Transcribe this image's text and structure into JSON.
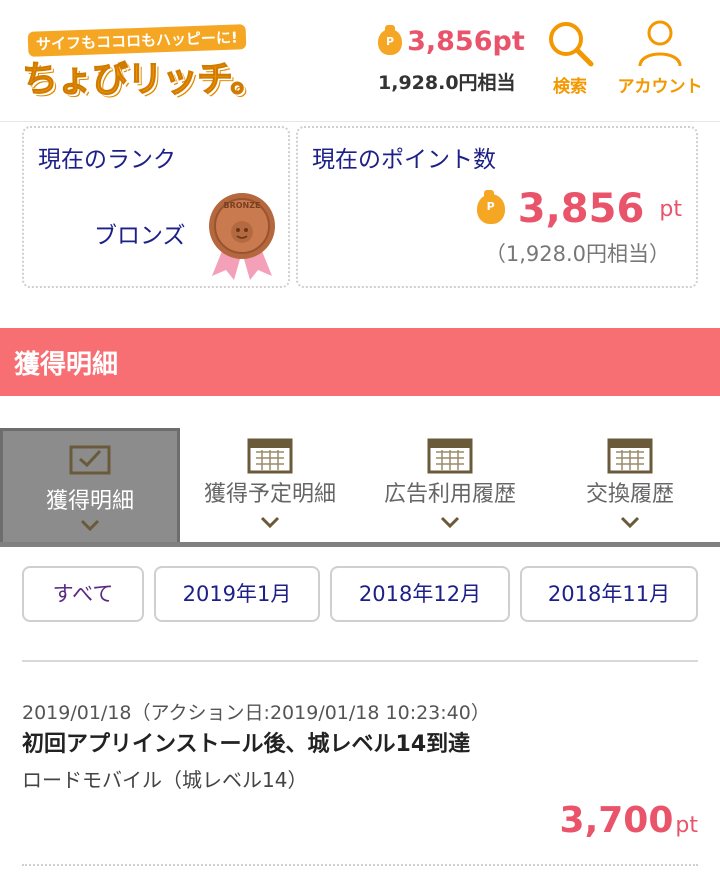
{
  "header": {
    "logo_tagline": "サイフもココロもハッピーに!",
    "logo_main": "ちょびリッチ。",
    "points": "3,856pt",
    "points_yen": "1,928.0円相当",
    "search_label": "検索",
    "account_label": "アカウント"
  },
  "rank_card": {
    "title": "現在のランク",
    "rank": "ブロンズ",
    "medal_text": "BRONZE"
  },
  "point_card": {
    "title": "現在のポイント数",
    "value": "3,856",
    "unit": "pt",
    "yen": "（1,928.0円相当）"
  },
  "section": {
    "title": "獲得明細"
  },
  "tabs": [
    {
      "label": "獲得明細",
      "icon": "envelope-check-icon",
      "active": true
    },
    {
      "label": "獲得予定明細",
      "icon": "calendar-icon",
      "active": false
    },
    {
      "label": "広告利用履歴",
      "icon": "calendar-icon",
      "active": false
    },
    {
      "label": "交換履歴",
      "icon": "calendar-icon",
      "active": false
    }
  ],
  "filters": [
    "すべて",
    "2019年1月",
    "2018年12月",
    "2018年11月"
  ],
  "entry": {
    "date": "2019/01/18（アクション日:2019/01/18  10:23:40）",
    "title": "初回アプリインストール後、城レベル14到達",
    "subtitle": "ロードモバイル（城レベル14）",
    "points": "3,700",
    "unit": "pt"
  },
  "colors": {
    "accent_orange": "#f39800",
    "points_pink": "#e9546b",
    "section_red": "#f76f73",
    "link_navy": "#1d2088"
  }
}
